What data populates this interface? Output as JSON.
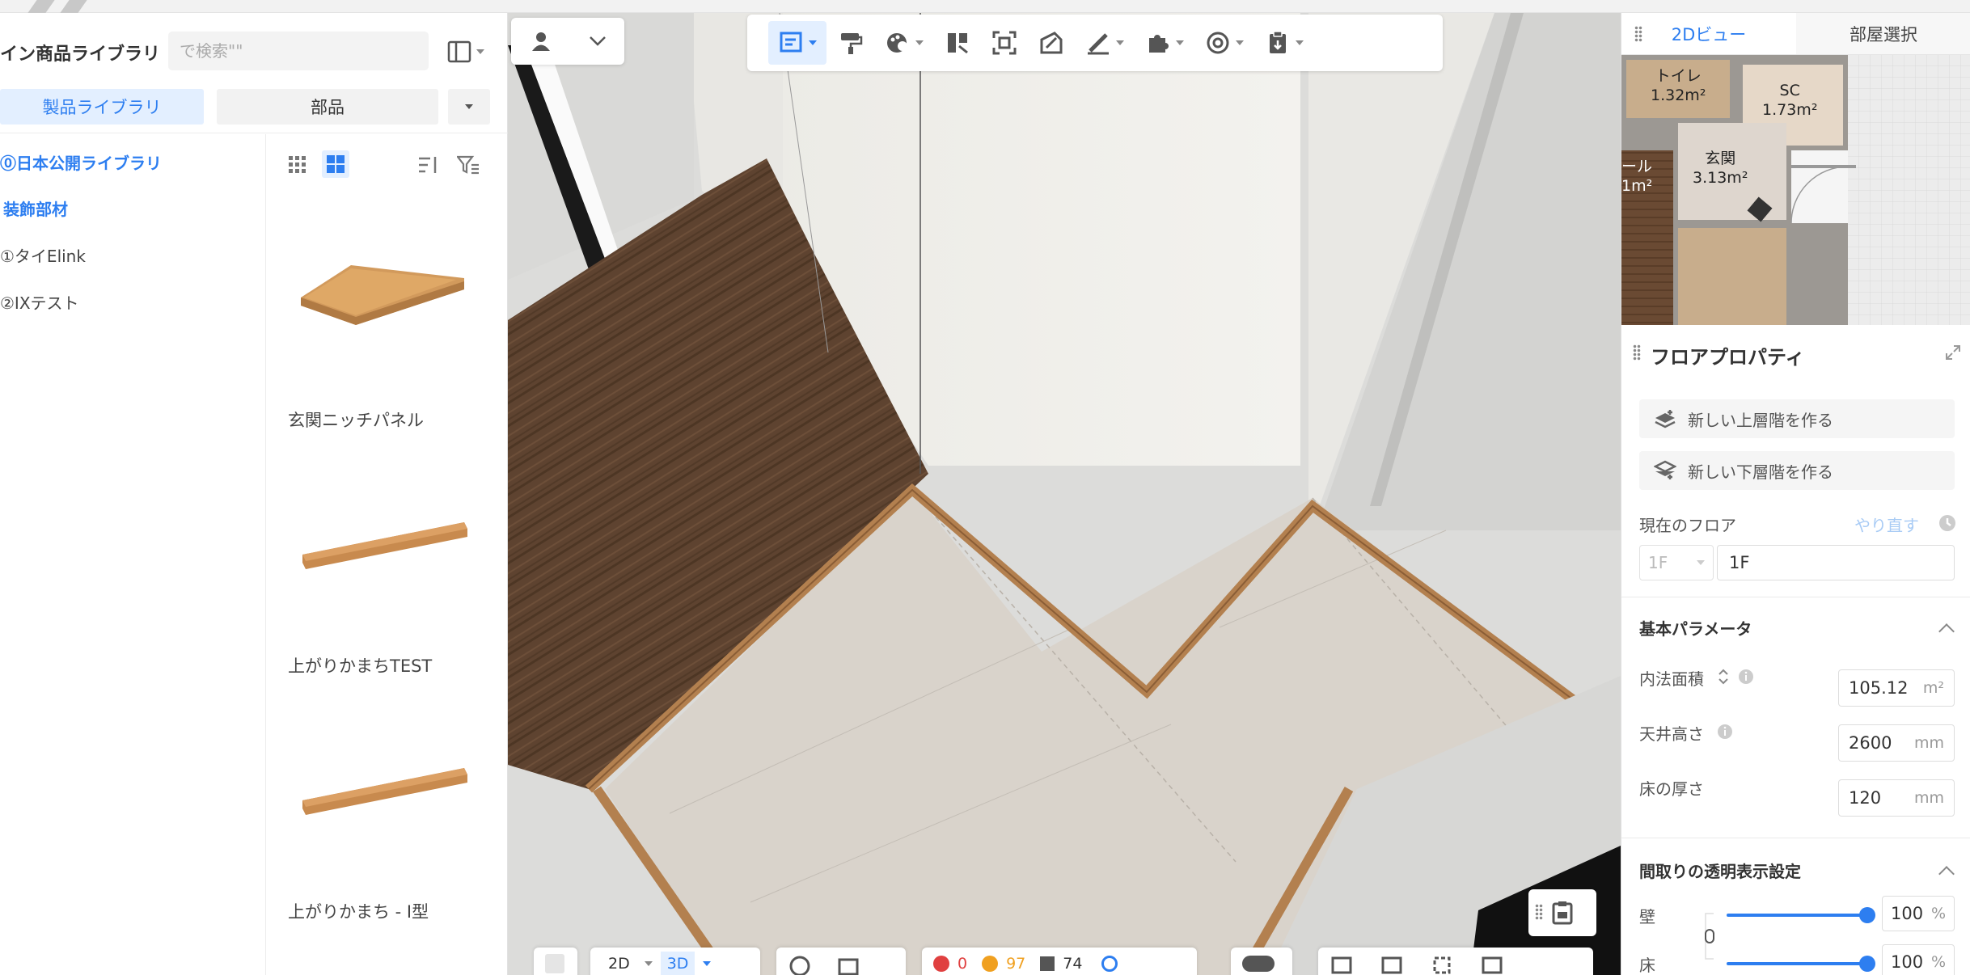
{
  "library": {
    "title": "イン商品ライブラリ",
    "search_placeholder": "で検索\"\"",
    "tabs": {
      "products": "製品ライブラリ",
      "parts": "部品"
    },
    "categories": [
      {
        "label": "⓪日本公開ライブラリ",
        "style": "blue"
      },
      {
        "label": "装飾部材",
        "style": "blue"
      },
      {
        "label": "①タイElink",
        "style": "plain"
      },
      {
        "label": "②IXテスト",
        "style": "plain"
      }
    ],
    "products": [
      {
        "name": "玄関ニッチパネル",
        "icon": "niche-panel-image"
      },
      {
        "name": "上がりかまちTEST",
        "icon": "step-board-image"
      },
      {
        "name": "上がりかまち - I型",
        "icon": "step-board-image"
      }
    ]
  },
  "toolbar": {
    "icons": [
      "floor-plan-icon",
      "paint-roller-icon",
      "color-palette-icon",
      "door-window-icon",
      "focus-icon",
      "material-icon",
      "measure-icon",
      "puzzle-icon",
      "target-icon",
      "clipboard-icon"
    ]
  },
  "bottombar": {
    "view_2d": "2D",
    "view_3d": "3D",
    "error_count": "0",
    "warning_count": "97",
    "item_count": "74"
  },
  "rightpanel": {
    "tabs": {
      "view2d": "2Dビュー",
      "room_select": "部屋選択"
    },
    "minimap": {
      "rooms": [
        {
          "name": "トイレ",
          "area": "1.32m²"
        },
        {
          "name": "SC",
          "area": "1.73m²"
        },
        {
          "name": "玄関",
          "area": "3.13m²"
        },
        {
          "name": "ール",
          "area": "1m²"
        }
      ]
    },
    "title": "フロアプロパティ",
    "new_upper_floor": "新しい上層階を作る",
    "new_lower_floor": "新しい下層階を作る",
    "current_floor_label": "現在のフロア",
    "redo_label": "やり直す",
    "floor_select": "1F",
    "floor_name": "1F",
    "basic_params": {
      "title": "基本パラメータ",
      "inner_area_label": "内法面積",
      "inner_area_value": "105.12",
      "inner_area_unit": "m²",
      "ceiling_height_label": "天井高さ",
      "ceiling_height_value": "2600",
      "ceiling_height_unit": "mm",
      "floor_thickness_label": "床の厚さ",
      "floor_thickness_value": "120",
      "floor_thickness_unit": "mm"
    },
    "transparency": {
      "title": "間取りの透明表示設定",
      "wall_label": "壁",
      "wall_value": "100",
      "floor_label": "床",
      "floor_value": "100",
      "unit": "%"
    }
  },
  "colors": {
    "accent": "#2d7ef0",
    "accent_light": "#e3efff"
  }
}
